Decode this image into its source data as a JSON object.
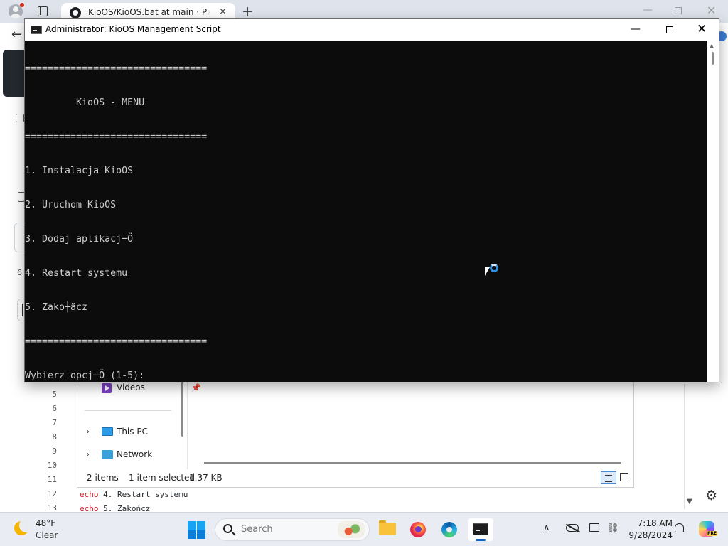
{
  "browser": {
    "tab_title": "KioOS/KioOS.bat at main · Piotrek",
    "tab_close": "×",
    "new_tab": "+"
  },
  "github": {
    "left_text": "6",
    "line_numbers": [
      "5",
      "6",
      "7",
      "8",
      "9",
      "10",
      "11",
      "12",
      "13"
    ],
    "code_line_12_kw": "echo",
    "code_line_12_text": " 4. Restart systemu",
    "code_line_13_kw": "echo",
    "code_line_13_text": " 5. Zakończ"
  },
  "explorer": {
    "nav": {
      "videos": "Videos",
      "this_pc": "This PC",
      "network": "Network"
    },
    "status": {
      "items": "2 items",
      "selected": "1 item selected",
      "size": "1.37 KB"
    }
  },
  "cmd": {
    "title": "Administrator:  KioOS Management Script",
    "console_lines": [
      "================================",
      "         KioOS - MENU",
      "================================",
      "1. Instalacja KioOS",
      "2. Uruchom KioOS",
      "3. Dodaj aplikacj─Ö",
      "4. Restart systemu",
      "5. Zako┼äcz",
      "================================",
      "Wybierz opcj─Ö (1-5):"
    ]
  },
  "taskbar": {
    "weather_temp": "48°F",
    "weather_condition": "Clear",
    "search_placeholder": "Search",
    "clock_time": "7:18 AM",
    "clock_date": "9/28/2024",
    "copilot_badge": "PRE"
  },
  "colors": {
    "console_bg": "#0c0c0c",
    "console_text": "#cccccc",
    "accent": "#0a66c2"
  }
}
